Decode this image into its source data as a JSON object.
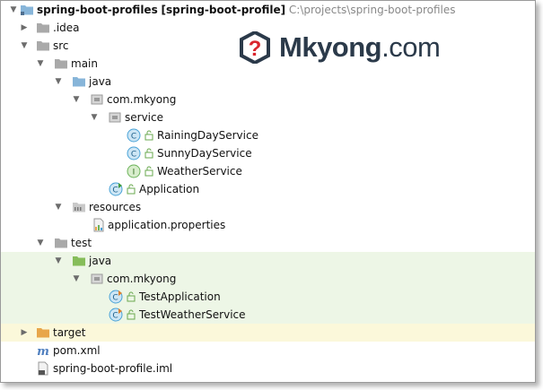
{
  "tree": {
    "project": {
      "name": "spring-boot-profiles",
      "module": "[spring-boot-profile]",
      "path": "C:\\projects\\spring-boot-profiles"
    },
    "idea": ".idea",
    "src": "src",
    "main": "main",
    "main_java": "java",
    "main_pkg": "com.mkyong",
    "service": "service",
    "raining": "RainingDayService",
    "sunny": "SunnyDayService",
    "weather": "WeatherService",
    "application": "Application",
    "resources": "resources",
    "app_props": "application.properties",
    "test": "test",
    "test_java": "java",
    "test_pkg": "com.mkyong",
    "test_app": "TestApplication",
    "test_weather": "TestWeatherService",
    "target": "target",
    "pom": "pom.xml",
    "iml": "spring-boot-profile.iml"
  },
  "logo": {
    "brand": "Mkyong",
    "suffix": ".com",
    "symbol": "?"
  },
  "colors": {
    "green_highlight": "#edf6e6",
    "yellow_highlight": "#fbf8da",
    "folder_blue": "#87b5d9",
    "folder_green": "#86bd5a",
    "folder_orange": "#e8a64a",
    "class_icon": "#4aa3d7",
    "interface_icon": "#6cb35a"
  }
}
